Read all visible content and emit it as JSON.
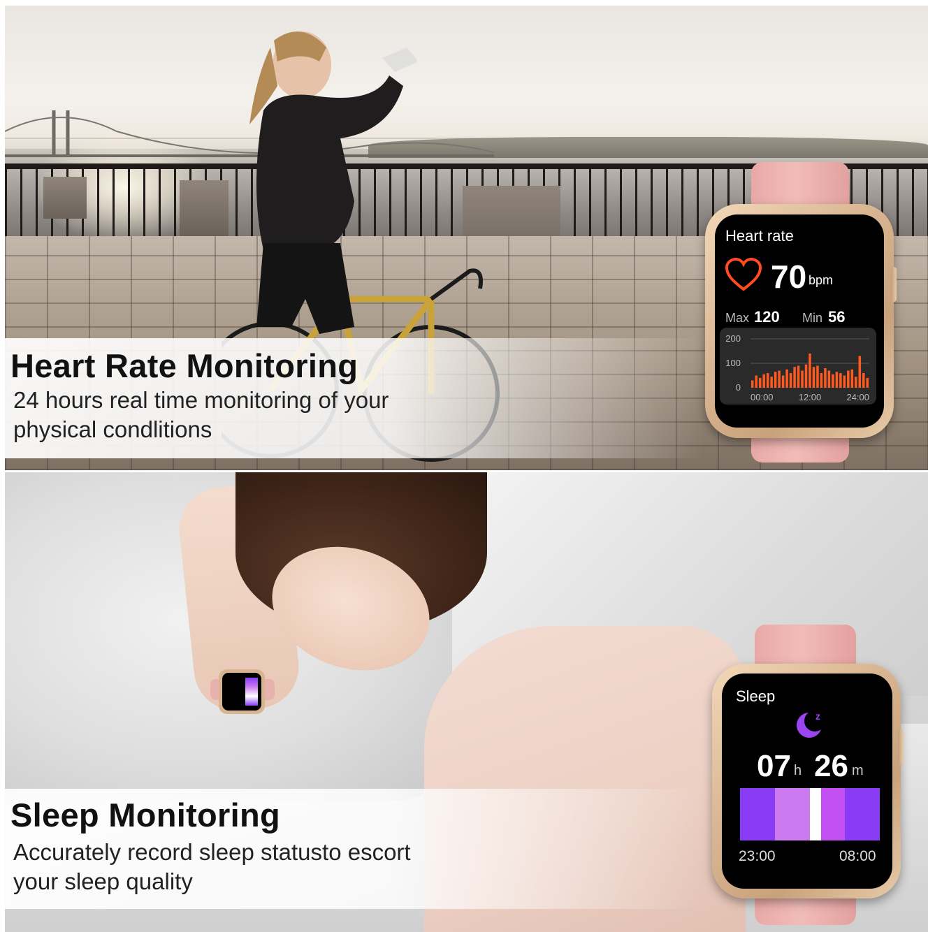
{
  "heart_section": {
    "title": "Heart Rate Monitoring",
    "description": "24 hours real time monitoring of your physical condlitions"
  },
  "sleep_section": {
    "title": "Sleep Monitoring",
    "description": "Accurately record sleep statusto escort your sleep quality"
  },
  "heart_watch": {
    "title": "Heart rate",
    "value": "70",
    "unit": "bpm",
    "max_label": "Max",
    "max_value": "120",
    "min_label": "Min",
    "min_value": "56",
    "chart": {
      "y_ticks": [
        "200",
        "100",
        "0"
      ],
      "x_ticks": [
        "00:00",
        "12:00",
        "24:00"
      ],
      "values": [
        30,
        50,
        40,
        55,
        60,
        45,
        65,
        70,
        50,
        75,
        60,
        85,
        90,
        70,
        95,
        140,
        85,
        90,
        60,
        80,
        70,
        55,
        65,
        60,
        50,
        70,
        75,
        45,
        130,
        60,
        40
      ]
    },
    "accent": "#ff5a1f"
  },
  "sleep_watch": {
    "title": "Sleep",
    "hours": "07",
    "hours_unit": "h",
    "minutes": "26",
    "minutes_unit": "m",
    "start": "23:00",
    "end": "08:00",
    "segments": [
      {
        "color": "#8a3cf5",
        "fraction": 0.25
      },
      {
        "color": "#cc7af0",
        "fraction": 0.25
      },
      {
        "color": "#ffffff",
        "fraction": 0.08
      },
      {
        "color": "#c24ff2",
        "fraction": 0.17
      },
      {
        "color": "#8a3cf5",
        "fraction": 0.25
      }
    ]
  }
}
